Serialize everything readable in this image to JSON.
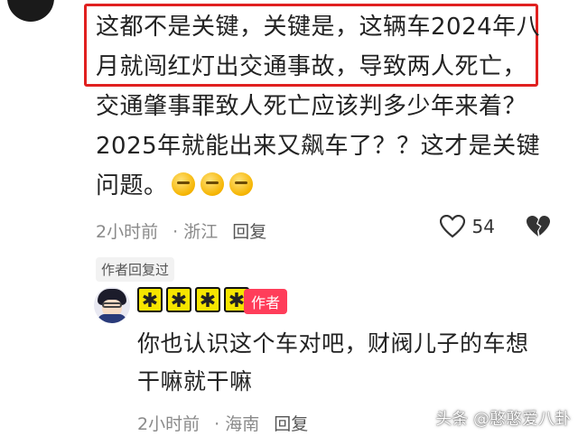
{
  "comment": {
    "lines": [
      "这都不是关键，关键是，这辆车2024年八",
      "月就闯红灯出交通事故，导致两人死亡，",
      "交通肇事罪致人死亡应该判多少年来着？",
      "2025年就能出来又飙车了？？这才是关键",
      "问题。"
    ],
    "emoji_count": 3,
    "time": "2小时前",
    "location": "浙江",
    "reply_label": "回复",
    "like_count": "54"
  },
  "author_replied_label": "作者回复过",
  "reply": {
    "username_stars": "****",
    "author_tag": "作者",
    "lines": [
      "你也认识这个车对吧，财阀儿子的车想",
      "干嘛就干嘛"
    ],
    "time": "2小时前",
    "location": "海南",
    "reply_label": "回复"
  },
  "watermark": "头条 @憨憨爱八卦",
  "colors": {
    "highlight": "#e0201f",
    "author_tag": "#ff3d5a",
    "stars": "#f6e500"
  }
}
